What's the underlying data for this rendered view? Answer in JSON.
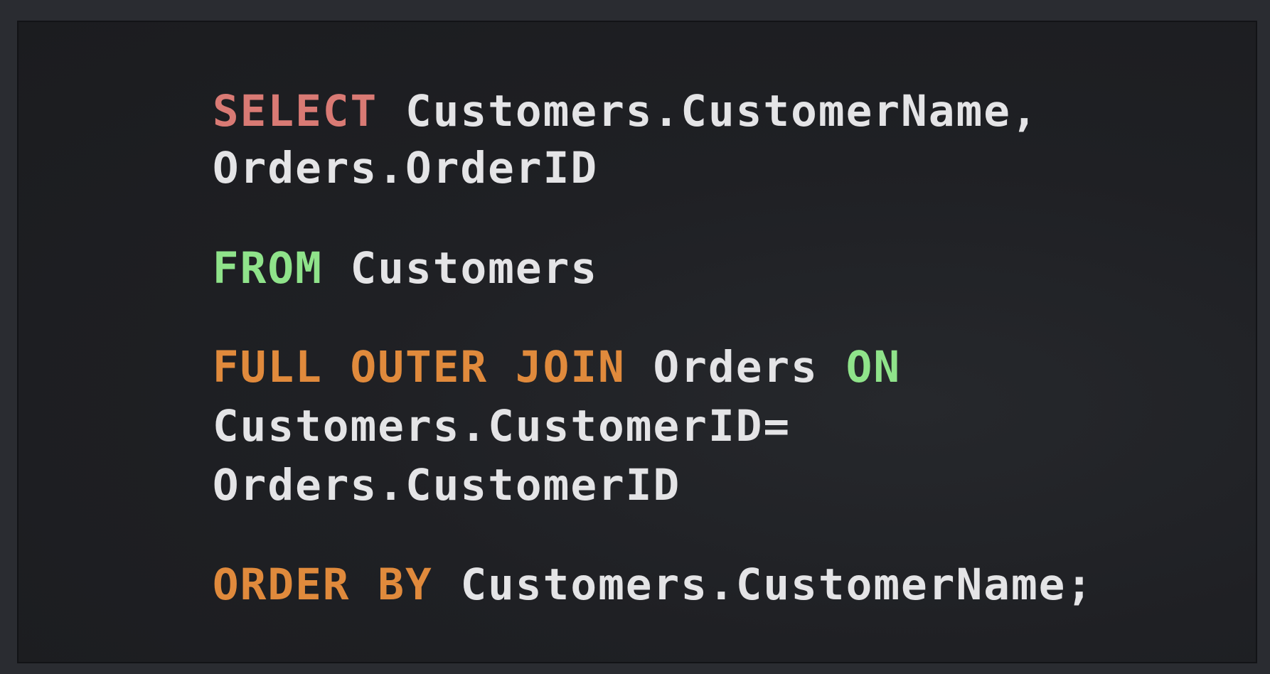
{
  "colors": {
    "background": "#2a2c31",
    "panel": "#1e1f23",
    "plain": "#e4e4e6",
    "select_keyword": "#d97a74",
    "green_keyword": "#8fe38a",
    "orange_keyword": "#e08a3c"
  },
  "code": {
    "lines": [
      [
        {
          "text": "SELECT",
          "kind": "select_keyword"
        },
        {
          "text": " Customers.CustomerName,",
          "kind": "plain"
        }
      ],
      [
        {
          "text": "Orders.OrderID",
          "kind": "plain"
        }
      ],
      [
        {
          "text": "FROM",
          "kind": "green_keyword"
        },
        {
          "text": " Customers",
          "kind": "plain"
        }
      ],
      [
        {
          "text": "FULL OUTER JOIN",
          "kind": "orange_keyword"
        },
        {
          "text": " Orders ",
          "kind": "plain"
        },
        {
          "text": "ON",
          "kind": "green_keyword"
        }
      ],
      [
        {
          "text": "Customers.CustomerID=",
          "kind": "plain"
        }
      ],
      [
        {
          "text": "Orders.CustomerID",
          "kind": "plain"
        }
      ],
      [
        {
          "text": "ORDER BY",
          "kind": "orange_keyword"
        },
        {
          "text": " Customers.CustomerName;",
          "kind": "plain"
        }
      ]
    ]
  }
}
